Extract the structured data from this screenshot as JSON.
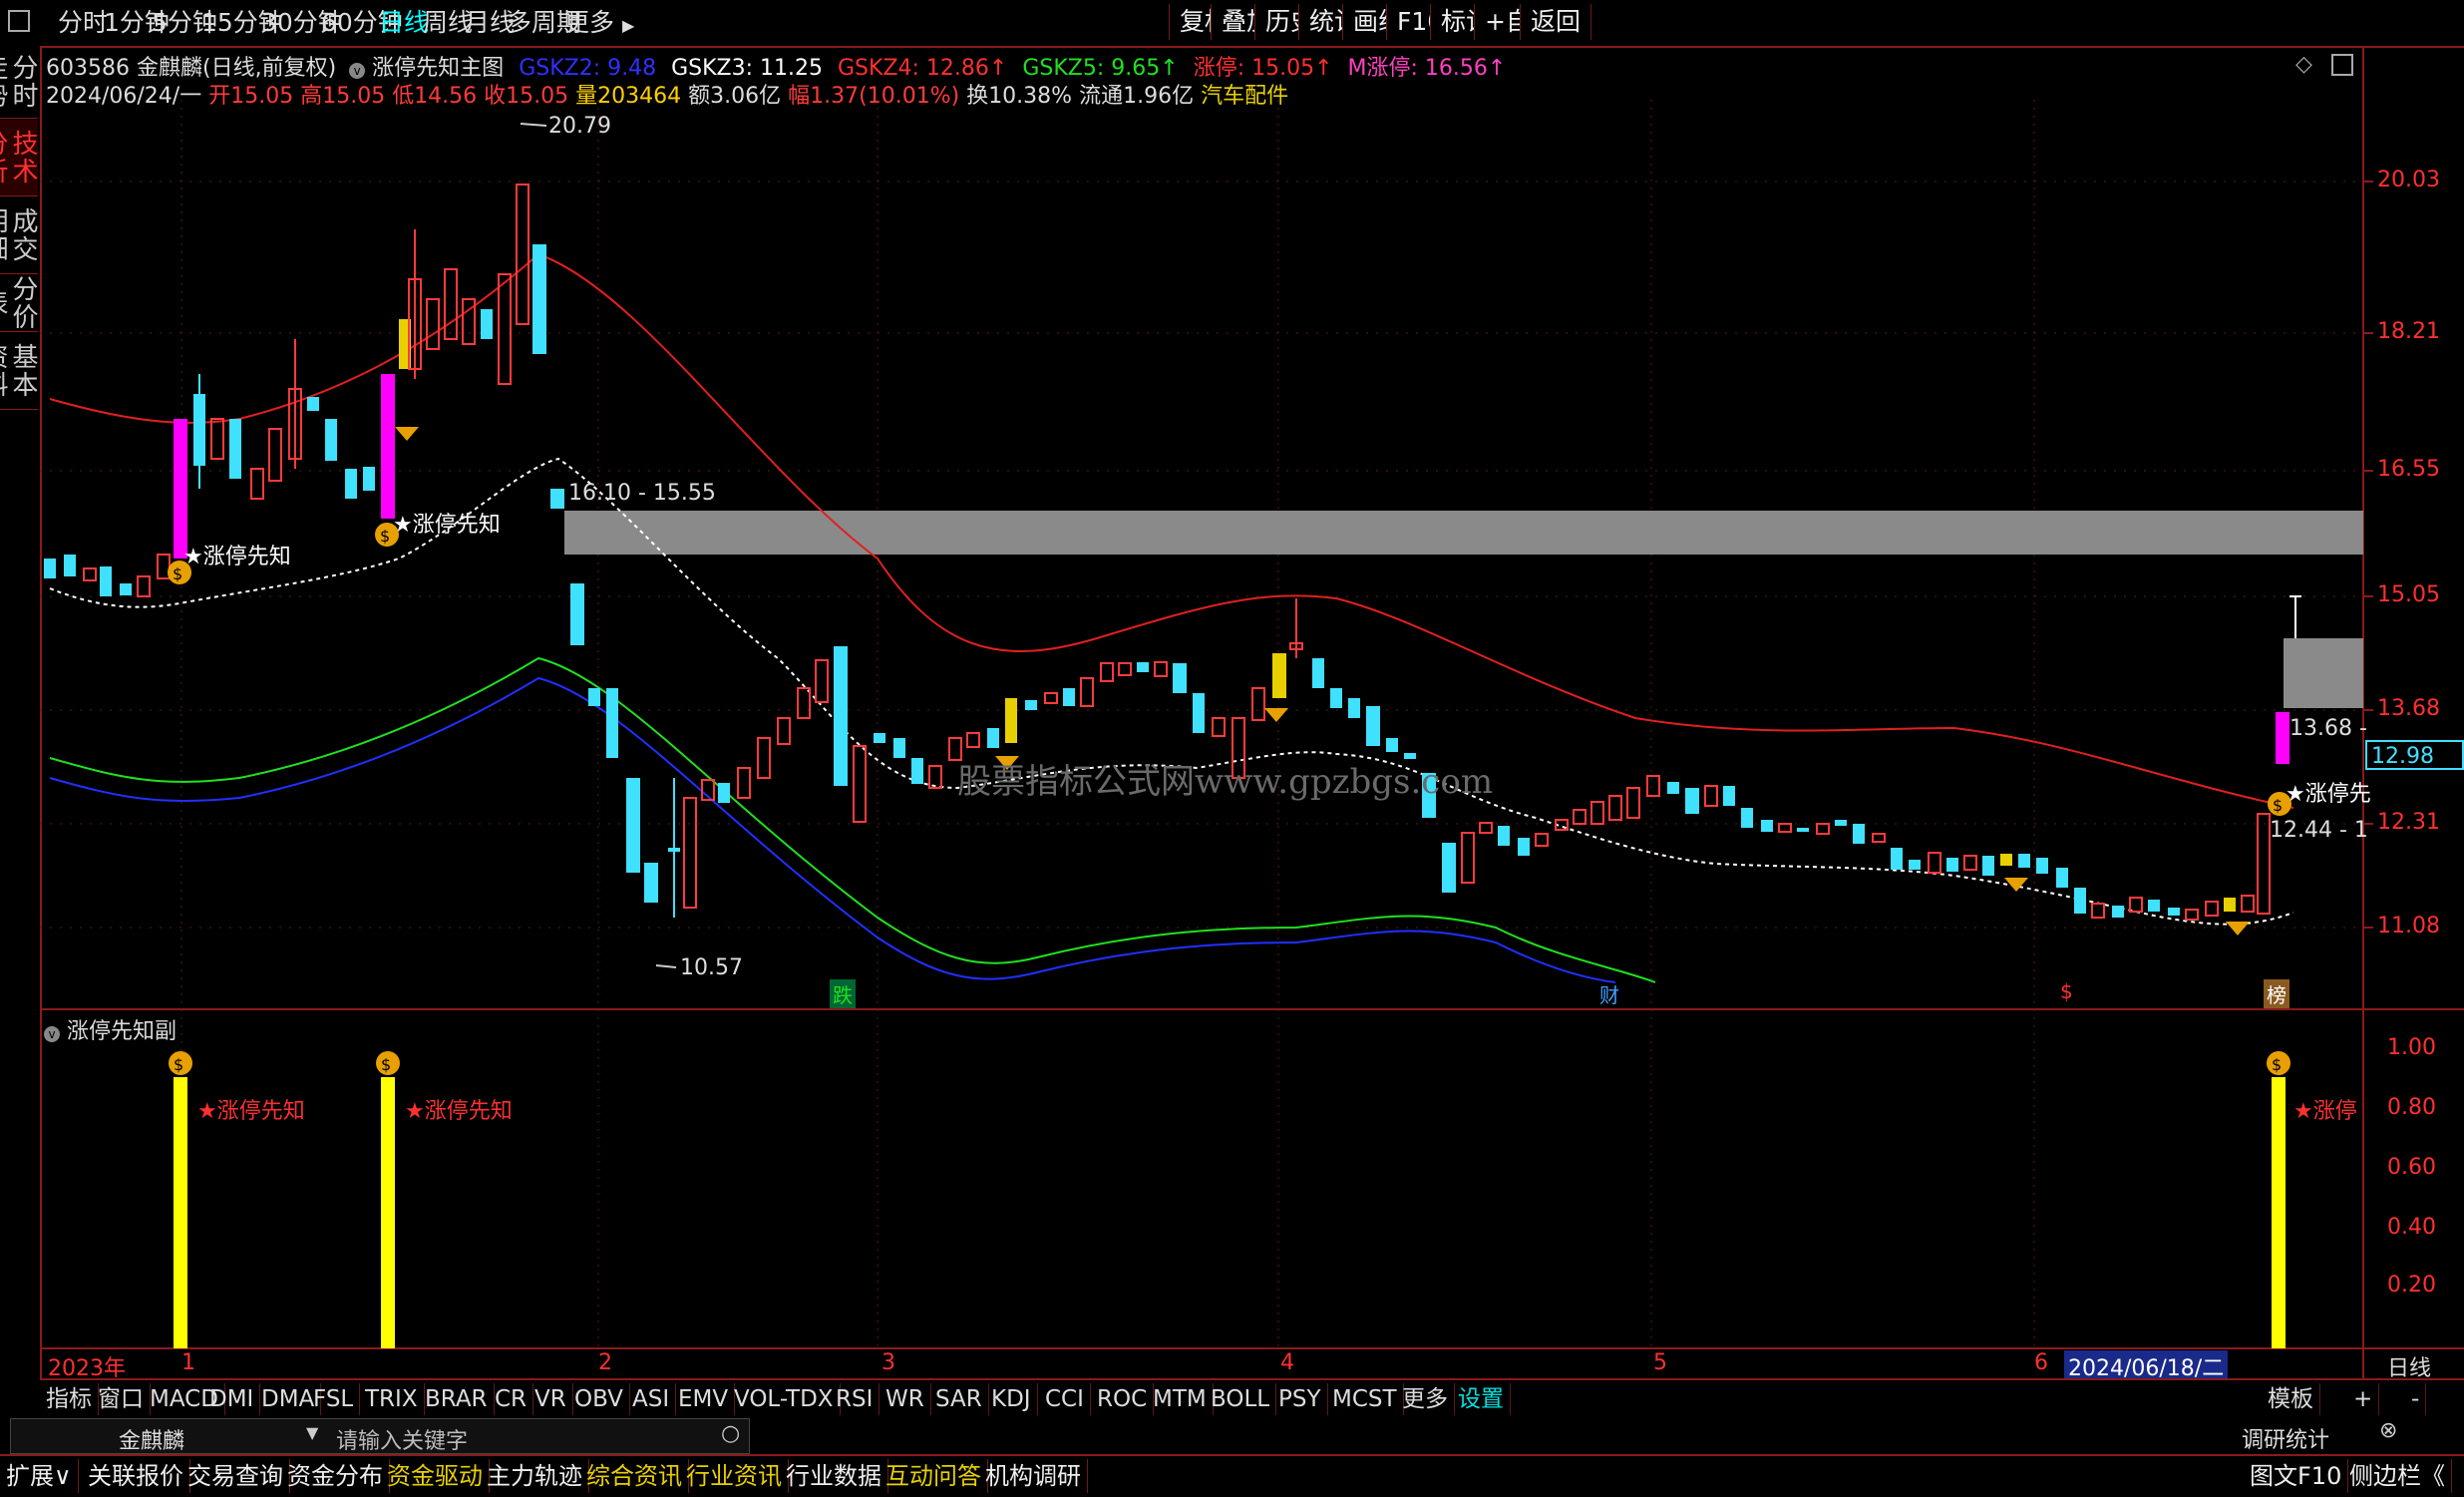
{
  "toolbar": {
    "periods": [
      "分时",
      "1分钟",
      "5分钟",
      "15分钟",
      "30分钟",
      "60分钟",
      "日线",
      "周线",
      "月线",
      "多周期",
      "更多"
    ],
    "active_period": "日线",
    "right_buttons": [
      "复权",
      "叠加",
      "历史",
      "统计",
      "画线",
      "F10",
      "标记",
      "+自选",
      "返回"
    ]
  },
  "sidebar": {
    "tabs": [
      "分时走势",
      "技术分析",
      "成交明细",
      "分价表",
      "基本资料"
    ],
    "active": "技术分析"
  },
  "header": {
    "code": "603586",
    "name": "金麒麟",
    "mode": "(日线,前复权)",
    "indicator": "涨停先知主图",
    "indicators": [
      {
        "label": "GSKZ2: 9.48",
        "color": "#3030ff"
      },
      {
        "label": "GSKZ3: 11.25",
        "color": "#ffffff"
      },
      {
        "label": "GSKZ4: 12.86",
        "color": "#ff3030"
      },
      {
        "label": "GSKZ5: 9.65",
        "color": "#20e020"
      },
      {
        "label": "涨停: 15.05",
        "color": "#ff3030"
      },
      {
        "label": "M涨停: 16.56",
        "color": "#ff40c0"
      }
    ],
    "date": "2024/06/24/一",
    "open": "开15.05",
    "high": "高15.05",
    "low": "低14.56",
    "close": "收15.05",
    "volume": "量203464",
    "amount": "额3.06亿",
    "change": "幅1.37(10.01%)",
    "turnover": "换10.38%",
    "float": "流通1.96亿",
    "sector": "汽车配件"
  },
  "price_axis": {
    "labels": [
      "20.03",
      "18.21",
      "16.55",
      "15.05",
      "13.68",
      "12.31",
      "11.08"
    ],
    "current": "12.98"
  },
  "annotations": {
    "high_label": "20.79",
    "low_label": "10.57",
    "zone_label": "16.10 - 15.55",
    "right_label1": "13.68 -",
    "right_label2": "12.44 - 1",
    "signal": "★涨停先知",
    "signal_short": "★涨停先",
    "markers": [
      "跌",
      "财",
      "$",
      "榜"
    ],
    "watermark": "股票指标公式网www.gpzbgs.com"
  },
  "sub_panel": {
    "title": "涨停先知副",
    "axis": [
      "1.00",
      "0.80",
      "0.60",
      "0.40",
      "0.20"
    ],
    "signal": "★涨停先知",
    "signal_short": "★涨停"
  },
  "time_axis": {
    "year": "2023年",
    "months": [
      "1",
      "2",
      "3",
      "4",
      "5",
      "6"
    ],
    "cursor": "2024/06/18/二",
    "right": "日线"
  },
  "indicator_tabs": [
    "指标",
    "窗口",
    "MACD",
    "DMI",
    "DMA",
    "FSL",
    "TRIX",
    "BRAR",
    "CR",
    "VR",
    "OBV",
    "ASI",
    "EMV",
    "VOL-TDX",
    "RSI",
    "WR",
    "SAR",
    "KDJ",
    "CCI",
    "ROC",
    "MTM",
    "BOLL",
    "PSY",
    "MCST",
    "更多",
    "设置"
  ],
  "indicator_tabs_right": [
    "模板",
    "+",
    "-"
  ],
  "search": {
    "stock": "金麒麟",
    "placeholder": "请输入关键字",
    "right": "调研统计"
  },
  "statusbar": {
    "items": [
      "扩展∨",
      "关联报价",
      "交易查询",
      "资金分布",
      "资金驱动",
      "主力轨迹",
      "综合资讯",
      "行业资讯",
      "行业数据",
      "互动问答",
      "机构调研"
    ],
    "right": [
      "图文F10",
      "侧边栏《"
    ]
  },
  "colors": {
    "up": "#ff3b3b",
    "down": "#40e0ff",
    "limit": "#ff00ff",
    "accent": "#e8d000"
  }
}
